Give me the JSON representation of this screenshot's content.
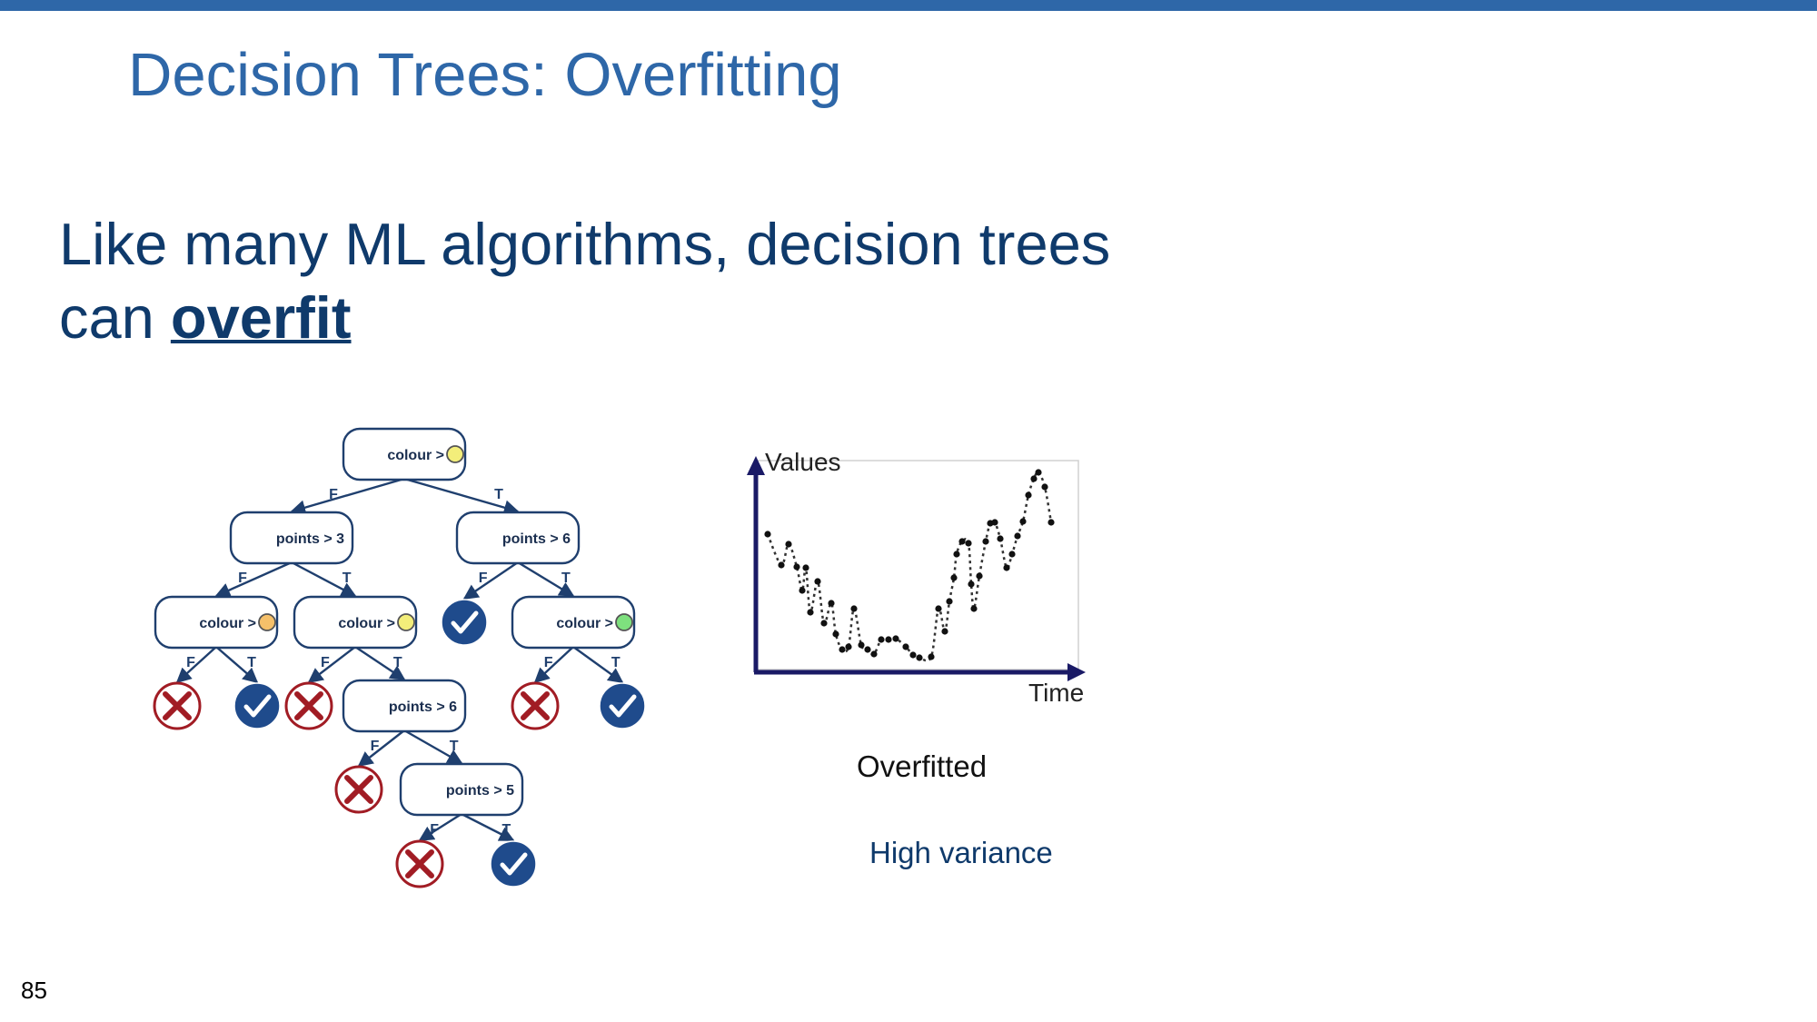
{
  "slide": {
    "title": "Decision Trees: Overfitting",
    "body_line1": "Like many ML algorithms, decision trees",
    "body_line2_prefix": "can ",
    "body_line2_emph": "overfit",
    "page_number": "85"
  },
  "tree": {
    "nodes": [
      {
        "id": "n1",
        "kind": "split",
        "label": "colour >",
        "swatch": "#f3ee7a"
      },
      {
        "id": "n2",
        "kind": "split",
        "label": "points > 3"
      },
      {
        "id": "n3",
        "kind": "split",
        "label": "points > 6"
      },
      {
        "id": "n4",
        "kind": "split",
        "label": "colour >",
        "swatch": "#f5c06a"
      },
      {
        "id": "n5",
        "kind": "split",
        "label": "colour >",
        "swatch": "#f3ee7a"
      },
      {
        "id": "n6",
        "kind": "leaf-true"
      },
      {
        "id": "n7",
        "kind": "split",
        "label": "colour >",
        "swatch": "#7ee07e"
      },
      {
        "id": "n8",
        "kind": "leaf-false"
      },
      {
        "id": "n9",
        "kind": "leaf-true"
      },
      {
        "id": "n10",
        "kind": "leaf-false"
      },
      {
        "id": "n11",
        "kind": "split",
        "label": "points > 6"
      },
      {
        "id": "n12",
        "kind": "leaf-false"
      },
      {
        "id": "n13",
        "kind": "leaf-true"
      },
      {
        "id": "n14",
        "kind": "leaf-false"
      },
      {
        "id": "n15",
        "kind": "split",
        "label": "points > 5"
      },
      {
        "id": "n16",
        "kind": "leaf-false"
      },
      {
        "id": "n17",
        "kind": "leaf-true"
      }
    ],
    "edges": [
      {
        "from": "n1",
        "to": "n2",
        "label": "F"
      },
      {
        "from": "n1",
        "to": "n3",
        "label": "T"
      },
      {
        "from": "n2",
        "to": "n4",
        "label": "F"
      },
      {
        "from": "n2",
        "to": "n5",
        "label": "T"
      },
      {
        "from": "n3",
        "to": "n6",
        "label": "F"
      },
      {
        "from": "n3",
        "to": "n7",
        "label": "T"
      },
      {
        "from": "n4",
        "to": "n8",
        "label": "F"
      },
      {
        "from": "n4",
        "to": "n9",
        "label": "T"
      },
      {
        "from": "n5",
        "to": "n10",
        "label": "F"
      },
      {
        "from": "n5",
        "to": "n11",
        "label": "T"
      },
      {
        "from": "n7",
        "to": "n12",
        "label": "F"
      },
      {
        "from": "n7",
        "to": "n13",
        "label": "T"
      },
      {
        "from": "n11",
        "to": "n14",
        "label": "F"
      },
      {
        "from": "n11",
        "to": "n15",
        "label": "T"
      },
      {
        "from": "n15",
        "to": "n16",
        "label": "F"
      },
      {
        "from": "n15",
        "to": "n17",
        "label": "T"
      }
    ],
    "colors": {
      "node_stroke": "#1f3f6e",
      "edge": "#1f3f6e",
      "true_leaf": "#1f4b8c",
      "false_leaf": "#a11c24"
    }
  },
  "plot": {
    "y_axis_label": "Values",
    "x_axis_label": "Time",
    "caption": "Overfitted",
    "note": "High variance",
    "axis_color": "#1a1a66"
  }
}
